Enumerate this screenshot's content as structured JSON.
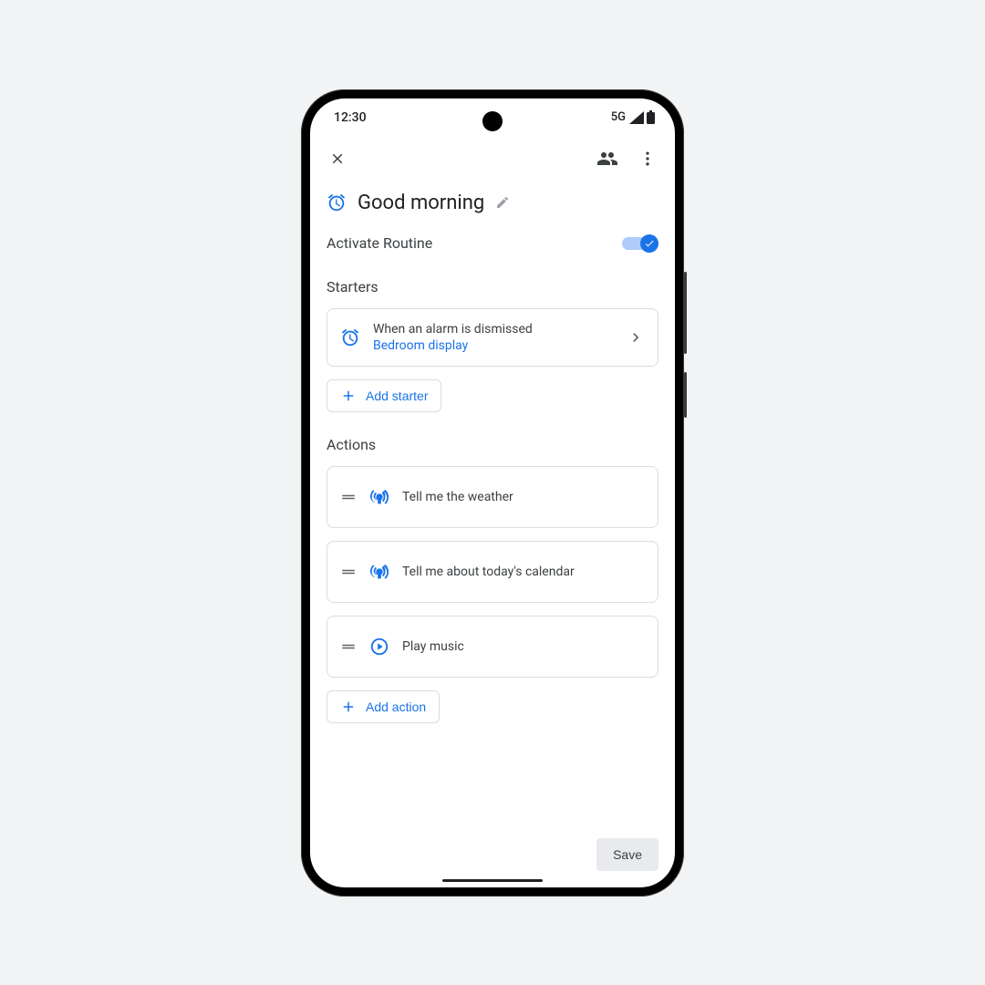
{
  "status": {
    "time": "12:30",
    "network": "5G"
  },
  "routine": {
    "title": "Good morning",
    "activate_label": "Activate Routine",
    "activated": true
  },
  "starters": {
    "header": "Starters",
    "items": [
      {
        "title": "When an alarm is dismissed",
        "subtitle": "Bedroom display"
      }
    ],
    "add_label": "Add starter"
  },
  "actions": {
    "header": "Actions",
    "items": [
      {
        "icon": "broadcast",
        "label": "Tell me the weather"
      },
      {
        "icon": "broadcast",
        "label": "Tell me about today's calendar"
      },
      {
        "icon": "play",
        "label": "Play music"
      }
    ],
    "add_label": "Add action"
  },
  "footer": {
    "save_label": "Save"
  }
}
